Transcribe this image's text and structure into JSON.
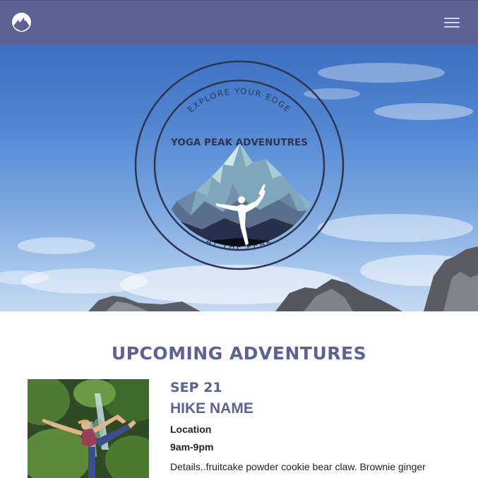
{
  "navbar": {
    "logo_icon": "mountain-circle-logo-icon",
    "menu_icon": "hamburger-menu-icon",
    "background_color": "#5c6294"
  },
  "hero": {
    "badge": {
      "top_text": "EXPLORE YOUR EDGE",
      "title": "YOGA PEAK ADVENUTRES",
      "bottom_text": "AT THE PEAK"
    }
  },
  "upcoming": {
    "heading": "UPCOMING ADVENTURES",
    "events": [
      {
        "date": "SEP 21",
        "name": "HIKE NAME",
        "location": "Location",
        "time": "9am-9pm",
        "details": "Details..fruitcake powder cookie bear claw. Brownie ginger"
      }
    ]
  },
  "colors": {
    "brand": "#5c6294",
    "badge_ink": "#2d3650",
    "text": "#222222"
  }
}
